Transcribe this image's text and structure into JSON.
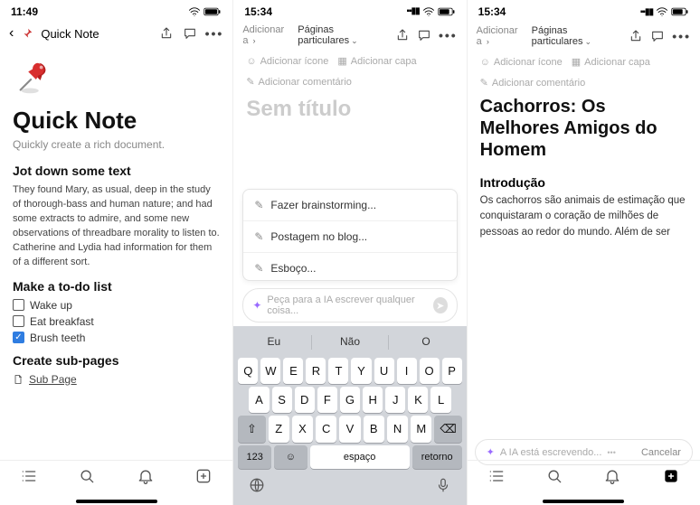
{
  "screen1": {
    "status_time": "11:49",
    "crumb_title": "Quick Note",
    "page_title": "Quick Note",
    "subtitle": "Quickly create a rich document.",
    "sec1_title": "Jot down some text",
    "sec1_body": "They found Mary, as usual, deep in the study of thorough-bass and human nature; and had some extracts to admire, and some new observations of threadbare morality to listen to. Catherine and Lydia had information for them of a different sort.",
    "sec2_title": "Make a to-do list",
    "todos": [
      {
        "label": "Wake up",
        "checked": false
      },
      {
        "label": "Eat breakfast",
        "checked": false
      },
      {
        "label": "Brush teeth",
        "checked": true
      }
    ],
    "sec3_title": "Create sub-pages",
    "subpage_label": "Sub Page"
  },
  "screen2": {
    "status_time": "15:34",
    "crumb_add": "Adicionar a",
    "crumb_loc": "Páginas particulares",
    "meta_icon": "Adicionar ícone",
    "meta_cover": "Adicionar capa",
    "meta_comment": "Adicionar comentário",
    "placeholder_title": "Sem título",
    "ai_items": [
      "Fazer brainstorming...",
      "Postagem no blog...",
      "Esboço..."
    ],
    "ai_input_placeholder": "Peça para a IA escrever qualquer coisa...",
    "kb_suggestions": [
      "Eu",
      "Não",
      "O"
    ],
    "kb_row1": [
      "Q",
      "W",
      "E",
      "R",
      "T",
      "Y",
      "U",
      "I",
      "O",
      "P"
    ],
    "kb_row2": [
      "A",
      "S",
      "D",
      "F",
      "G",
      "H",
      "J",
      "K",
      "L"
    ],
    "kb_row3": [
      "Z",
      "X",
      "C",
      "V",
      "B",
      "N",
      "M"
    ],
    "kb_shift": "⇧",
    "kb_backspace": "⌫",
    "kb_123": "123",
    "kb_emoji": "☺",
    "kb_space": "espaço",
    "kb_return": "retorno"
  },
  "screen3": {
    "status_time": "15:34",
    "crumb_add": "Adicionar a",
    "crumb_loc": "Páginas particulares",
    "meta_icon": "Adicionar ícone",
    "meta_cover": "Adicionar capa",
    "meta_comment": "Adicionar comentário",
    "title": "Cachorros: Os Melhores Amigos do Homem",
    "h2": "Introdução",
    "body": "Os cachorros são animais de estimação que conquistaram o coração de milhões de pessoas ao redor do mundo. Além de ser",
    "ai_writing": "A IA está escrevendo...",
    "ai_dots": "•••",
    "cancel": "Cancelar"
  }
}
